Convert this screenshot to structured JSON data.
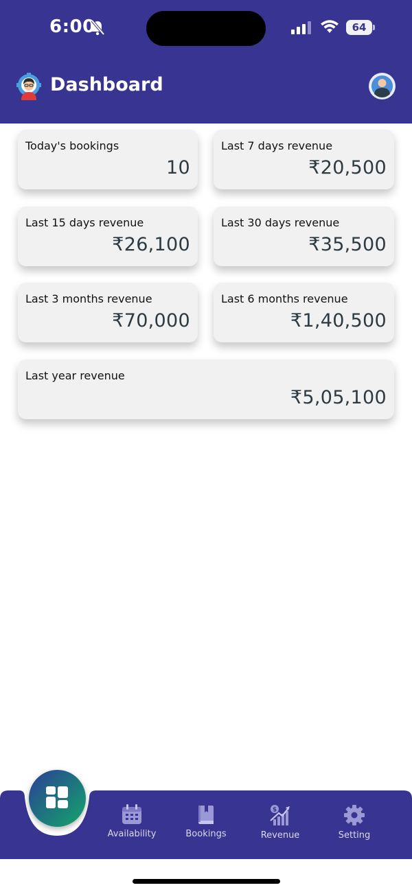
{
  "status_bar": {
    "time": "6:00",
    "battery": "64"
  },
  "header": {
    "title": "Dashboard"
  },
  "cards": [
    {
      "label": "Today's bookings",
      "value": "10"
    },
    {
      "label": "Last 7 days revenue",
      "value": "₹20,500"
    },
    {
      "label": "Last 15 days revenue",
      "value": "₹26,100"
    },
    {
      "label": "Last 30 days revenue",
      "value": "₹35,500"
    },
    {
      "label": "Last 3 months revenue",
      "value": "₹70,000"
    },
    {
      "label": "Last 6 months revenue",
      "value": "₹1,40,500"
    },
    {
      "label": "Last year revenue",
      "value": "₹5,05,100"
    }
  ],
  "bottom_nav": {
    "items": [
      {
        "label": "Availability",
        "icon": "calendar-icon"
      },
      {
        "label": "Bookings",
        "icon": "book-icon"
      },
      {
        "label": "Revenue",
        "icon": "revenue-chart-icon"
      },
      {
        "label": "Setting",
        "icon": "gear-icon"
      }
    ],
    "fab_icon": "dashboard-grid-icon"
  },
  "colors": {
    "primary": "#383491",
    "card_bg": "#f1f1f1",
    "value_text": "#2d3a42",
    "fab_gradient_start": "#2b3f96",
    "fab_gradient_end": "#13a66a"
  }
}
